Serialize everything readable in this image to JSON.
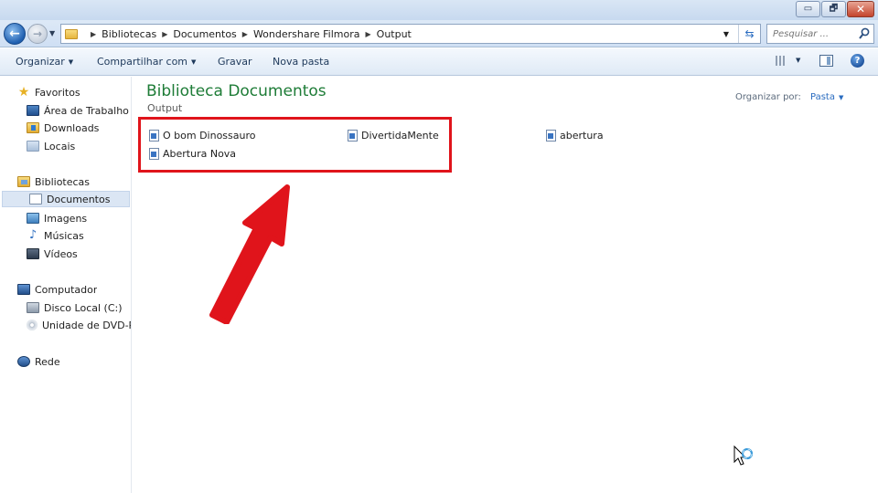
{
  "window": {
    "controls": {
      "minimize": "▭",
      "maximize": "🗗",
      "close": "✕"
    }
  },
  "address_bar": {
    "crumbs": [
      "Bibliotecas",
      "Documentos",
      "Wondershare Filmora",
      "Output"
    ]
  },
  "search": {
    "placeholder": "Pesquisar ..."
  },
  "command_bar": {
    "organize": "Organizar",
    "share": "Compartilhar com",
    "burn": "Gravar",
    "new_folder": "Nova pasta"
  },
  "sidebar": {
    "favorites": {
      "label": "Favoritos",
      "items": [
        "Área de Trabalho",
        "Downloads",
        "Locais"
      ]
    },
    "libraries": {
      "label": "Bibliotecas",
      "items": [
        "Documentos",
        "Imagens",
        "Músicas",
        "Vídeos"
      ],
      "selected": "Documentos"
    },
    "computer": {
      "label": "Computador",
      "items": [
        "Disco Local (C:)",
        "Unidade de DVD-RW"
      ]
    },
    "network": {
      "label": "Rede"
    }
  },
  "main": {
    "title": "Biblioteca Documentos",
    "subtitle": "Output",
    "arrange_label": "Organizar por:",
    "arrange_value": "Pasta",
    "files": [
      "O bom Dinossauro",
      "DivertidaMente",
      "abertura",
      "Abertura Nova"
    ]
  },
  "colors": {
    "title_green": "#1e7c37",
    "annotation_red": "#e0141b",
    "link_blue": "#2a6cc0"
  }
}
